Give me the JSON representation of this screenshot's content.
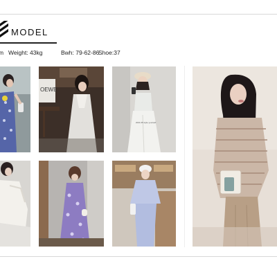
{
  "header": {
    "title": "MODEL",
    "logo": "stripe-logo-icon"
  },
  "stats": [
    {
      "text": "m"
    },
    {
      "text": "Weight: 43kg"
    },
    {
      "text": "Bwh: 79-62-86"
    },
    {
      "text": "Shoe:37"
    }
  ],
  "gallery": {
    "photos": [
      {
        "name": "photo-blue-floral-dress"
      },
      {
        "name": "photo-white-slip-dress"
      },
      {
        "name": "photo-white-tank-pants"
      },
      {
        "name": "photo-white-blouse"
      },
      {
        "name": "photo-purple-floral-dress"
      },
      {
        "name": "photo-lavender-hoodie-set"
      },
      {
        "name": "photo-striped-sweater-knit-skirt"
      }
    ],
    "sign_text": "OEWE",
    "shirt_print": "2021.05 style yourself"
  },
  "colors": {
    "rule": "#d8d8d8",
    "accent": "#111111"
  }
}
